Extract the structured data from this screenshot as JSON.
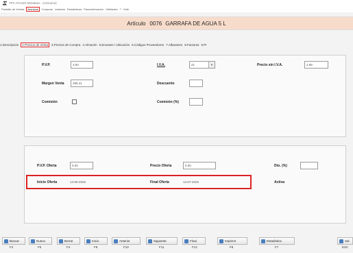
{
  "window": {
    "title": "TPV ATASIO Miradaes - (Articulos)"
  },
  "menu": {
    "items": [
      "Pantalla de Ventas",
      "Archivos",
      "Compras",
      "Listados",
      "Estadisticas",
      "Parametrizacion",
      "Utilidades",
      "?",
      "Salir"
    ]
  },
  "header": {
    "label": "Artículo",
    "code": "0076",
    "name": "GARRAFA DE AGUA 5 L"
  },
  "tabs": [
    "1.Descripción",
    "2.Precios de Venta",
    "3.Precios de Compra",
    "4.Almacén",
    "5.Envases / Ubicación",
    "6.Códigos Proveedores",
    "7.Albaranes",
    "8.Facturas",
    "9.Pr"
  ],
  "form": {
    "pvp_label": "P.V.P.",
    "pvp_value": "3.50",
    "iva_label": "I.V.A.",
    "iva_value": "21",
    "precio_sin_iva_label": "Precio sin I.V.A.",
    "precio_sin_iva_value": "2.89",
    "margen_label": "Margen Venta",
    "margen_value": "289.41",
    "descuento_label": "Descuento",
    "descuento_value": "",
    "comision_label": "Comisión",
    "comision_pct_label": "Comisión (%)",
    "comision_pct_value": "",
    "pvp_oferta_label": "P.V.P. Oferta",
    "pvp_oferta_value": "0.00",
    "precio_oferta_label": "Precio Oferta",
    "precio_oferta_value": "0.00",
    "dto_label": "Dto. (%)",
    "dto_value": "",
    "inicio_label": "Inicio Oferta",
    "inicio_value": "13-06-2025",
    "final_label": "Final Oferta",
    "final_value": "13-07-2025",
    "activa_label": "Activa"
  },
  "footer": {
    "buttons": [
      {
        "label": "Buscar",
        "key": "F2"
      },
      {
        "label": "Nuevo",
        "key": "F5"
      },
      {
        "label": "Borrar",
        "key": "F4"
      },
      {
        "label": "Inicio",
        "key": "F9"
      },
      {
        "label": "Anterior",
        "key": "F10"
      },
      {
        "label": "Siguiente",
        "key": "F11"
      },
      {
        "label": "Final",
        "key": "F12"
      },
      {
        "label": "Imprimir",
        "key": "F8"
      },
      {
        "label": "Estadistica",
        "key": "F7"
      },
      {
        "label": "Sal",
        "key": "ESC"
      }
    ]
  },
  "colors": {
    "header_bg": "#f7dccb",
    "highlight": "#d22222"
  }
}
